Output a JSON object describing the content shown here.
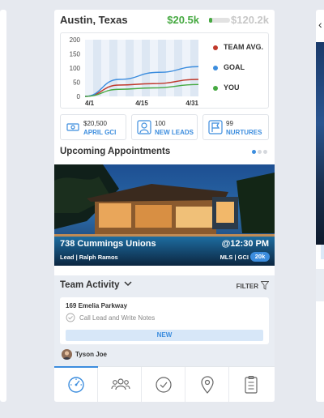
{
  "header": {
    "city": "Austin, Texas",
    "goal_current": "$20.5k",
    "goal_max": "$120.2k",
    "goal_progress": 0.17,
    "colors": {
      "current": "#46a941",
      "max": "#c7c7c7"
    }
  },
  "chart_data": {
    "type": "line",
    "x": [
      "4/1",
      "4/15",
      "4/31"
    ],
    "y_ticks": [
      "200",
      "150",
      "100",
      "50",
      "0"
    ],
    "ylim": [
      0,
      200
    ],
    "series": [
      {
        "name": "TEAM AVG.",
        "color": "#c0392b",
        "points": [
          [
            0,
            0
          ],
          [
            0.3,
            40
          ],
          [
            0.6,
            45
          ],
          [
            1,
            60
          ]
        ]
      },
      {
        "name": "GOAL",
        "color": "#3c8dde",
        "points": [
          [
            0,
            0
          ],
          [
            0.3,
            60
          ],
          [
            0.65,
            85
          ],
          [
            1,
            105
          ]
        ]
      },
      {
        "name": "YOU",
        "color": "#46a941",
        "points": [
          [
            0,
            0
          ],
          [
            0.3,
            25
          ],
          [
            0.6,
            30
          ],
          [
            1,
            42
          ]
        ]
      }
    ]
  },
  "stats": [
    {
      "value": "$20,500",
      "label": "APRIL GCI",
      "icon": "money-icon"
    },
    {
      "value": "100",
      "label": "NEW LEADS",
      "icon": "person-icon"
    },
    {
      "value": "99",
      "label": "NURTURES",
      "icon": "flag-icon"
    }
  ],
  "appointments": {
    "title": "Upcoming Appointments",
    "address": "738 Cummings Unions",
    "time": "@12:30 PM",
    "lead": "Lead | Ralph Ramos",
    "mls": "MLS | GCI",
    "gci": "20k"
  },
  "team": {
    "title": "Team Activity",
    "filter": "FILTER",
    "task": {
      "address": "169 Emelia Parkway",
      "action": "Call Lead  and Write Notes",
      "status": "NEW"
    },
    "owner": "Tyson Joe"
  },
  "tabs": [
    "dashboard-icon",
    "team-icon",
    "tasks-icon",
    "map-pin-icon",
    "clipboard-icon"
  ],
  "accent": "#3c8dde"
}
